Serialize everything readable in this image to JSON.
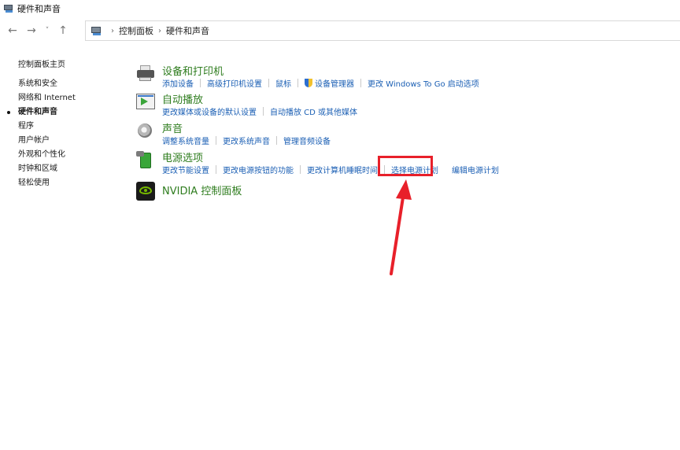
{
  "window": {
    "title": "硬件和声音"
  },
  "nav": {
    "back_icon": "arrow-left-icon",
    "forward_icon": "arrow-right-icon",
    "recent_icon": "chevron-down-icon",
    "up_icon": "arrow-up-icon",
    "breadcrumbs": [
      "控制面板",
      "硬件和声音"
    ]
  },
  "sidebar": {
    "home": "控制面板主页",
    "items": [
      {
        "label": "系统和安全"
      },
      {
        "label": "网络和 Internet"
      },
      {
        "label": "硬件和声音",
        "active": true
      },
      {
        "label": "程序"
      },
      {
        "label": "用户帐户"
      },
      {
        "label": "外观和个性化"
      },
      {
        "label": "时钟和区域"
      },
      {
        "label": "轻松使用"
      }
    ]
  },
  "categories": [
    {
      "title": "设备和打印机",
      "icon": "printer-icon",
      "links": [
        "添加设备",
        "高级打印机设置",
        "鼠标",
        "设备管理器",
        "更改 Windows To Go 启动选项"
      ]
    },
    {
      "title": "自动播放",
      "icon": "autoplay-icon",
      "links": [
        "更改媒体或设备的默认设置",
        "自动播放 CD 或其他媒体"
      ]
    },
    {
      "title": "声音",
      "icon": "speaker-icon",
      "links": [
        "调整系统音量",
        "更改系统声音",
        "管理音频设备"
      ]
    },
    {
      "title": "电源选项",
      "icon": "power-battery-icon",
      "links": [
        "更改节能设置",
        "更改电源按钮的功能",
        "更改计算机睡眠时间",
        "选择电源计划",
        "编辑电源计划"
      ]
    },
    {
      "title": "NVIDIA 控制面板",
      "icon": "nvidia-icon",
      "links": []
    }
  ],
  "annotation": {
    "color": "#e8202a",
    "target": "选择电源计划"
  }
}
